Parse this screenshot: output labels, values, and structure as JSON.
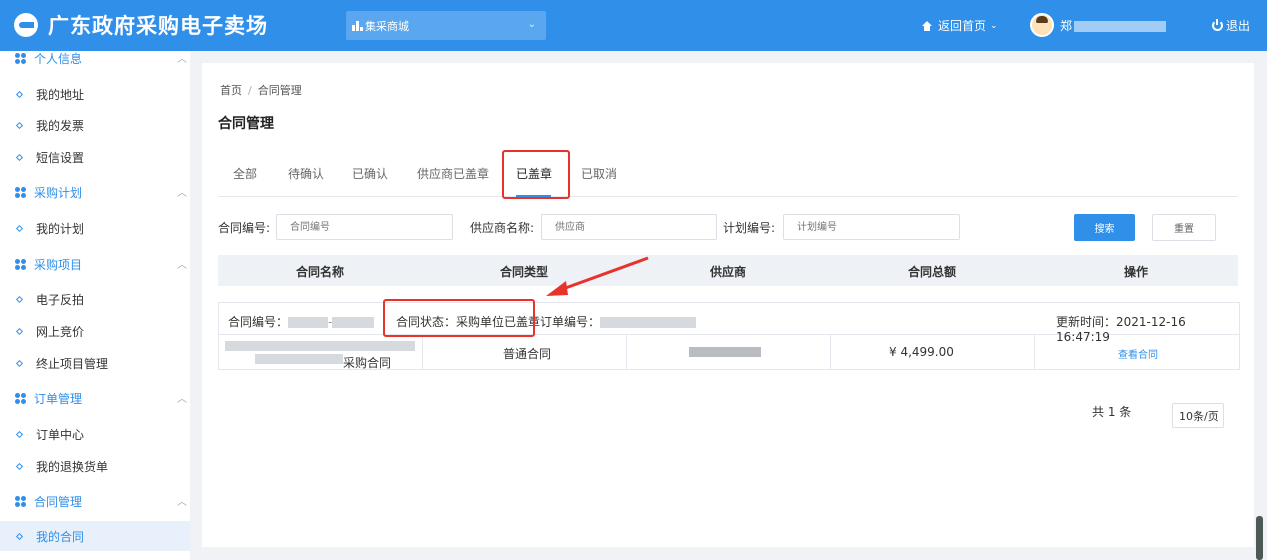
{
  "header": {
    "logo_text": "广东政府采购电子卖场",
    "mall_select": "集采商城",
    "home_link": "返回首页",
    "user_name_visible": "郑",
    "logout": "退出"
  },
  "sidebar": {
    "groups": [
      {
        "label": "个人信息",
        "items": [
          "我的地址",
          "我的发票",
          "短信设置"
        ]
      },
      {
        "label": "采购计划",
        "items": [
          "我的计划"
        ]
      },
      {
        "label": "采购项目",
        "items": [
          "电子反拍",
          "网上竞价",
          "终止项目管理"
        ]
      },
      {
        "label": "订单管理",
        "items": [
          "订单中心",
          "我的退换货单"
        ]
      },
      {
        "label": "合同管理",
        "items": [
          "我的合同"
        ]
      }
    ],
    "active_item": "我的合同"
  },
  "breadcrumb": {
    "home": "首页",
    "separator": "/",
    "current": "合同管理"
  },
  "page_title": "合同管理",
  "tabs": [
    "全部",
    "待确认",
    "已确认",
    "供应商已盖章",
    "已盖章",
    "已取消"
  ],
  "active_tab": "已盖章",
  "filters": {
    "contract_no_label": "合同编号:",
    "contract_no_placeholder": "合同编号",
    "supplier_label": "供应商名称:",
    "supplier_placeholder": "供应商",
    "plan_no_label": "计划编号:",
    "plan_no_placeholder": "计划编号",
    "search_button": "搜索",
    "reset_button": "重置"
  },
  "table": {
    "headers": [
      "合同名称",
      "合同类型",
      "供应商",
      "合同总额",
      "操作"
    ],
    "orders": [
      {
        "contract_no_label": "合同编号：",
        "status_label": "合同状态：采购单位已盖章",
        "order_no_label": "订单编号：",
        "updated_label": "更新时间：2021-12-16 16:47:19",
        "contract_name_suffix": "采购合同",
        "contract_type": "普通合同",
        "amount": "¥ 4,499.00",
        "action": "查看合同"
      }
    ]
  },
  "pagination": {
    "total": "共 1 条",
    "page_size": "10条/页"
  },
  "colors": {
    "primary": "#2f8fe9",
    "highlight": "#e8322c"
  }
}
